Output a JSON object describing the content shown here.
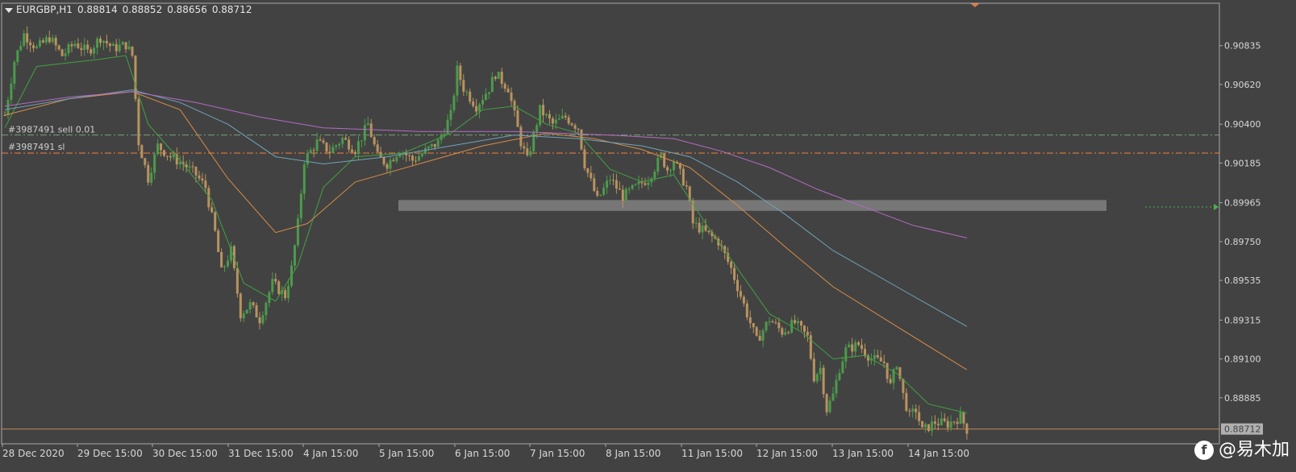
{
  "header": {
    "symbol": "EURGBP,H1",
    "open": "0.88814",
    "high": "0.88852",
    "low": "0.88656",
    "close": "0.88712"
  },
  "orders": {
    "sell_label": "#3987491 sell 0.01",
    "sl_label": "#3987491 sl"
  },
  "watermark": "@易木加",
  "colors": {
    "background": "#424242",
    "bull": "#4c9a4c",
    "bear": "#b8935f",
    "ema_fast": "#42a142",
    "ema_mid": "#d98c45",
    "ema_slow": "#6fa3b8",
    "ema_long": "#b56bc4",
    "sell_line": "#7aa07a",
    "sl_line": "#e07a3a",
    "price_line": "#c08a55",
    "zone": "#8a8a8a"
  },
  "chart_data": {
    "type": "candlestick",
    "y_ticks": [
      "0.90835",
      "0.90620",
      "0.90400",
      "0.90185",
      "0.89965",
      "0.89750",
      "0.89535",
      "0.89315",
      "0.89100",
      "0.88885"
    ],
    "ylim": [
      0.8863,
      0.9107
    ],
    "x_ticks": [
      "28 Dec 2020",
      "29 Dec 15:00",
      "30 Dec 15:00",
      "31 Dec 15:00",
      "4 Jan 15:00",
      "5 Jan 15:00",
      "6 Jan 15:00",
      "7 Jan 15:00",
      "8 Jan 15:00",
      "11 Jan 15:00",
      "12 Jan 15:00",
      "13 Jan 15:00",
      "14 Jan 15:00"
    ],
    "current_price": "0.88712",
    "sell_price": 0.9034,
    "sl_price": 0.9024,
    "zone": {
      "low": 0.8992,
      "high": 0.8998
    },
    "close_path": [
      [
        0,
        0.9045
      ],
      [
        3,
        0.9075
      ],
      [
        6,
        0.909
      ],
      [
        10,
        0.9082
      ],
      [
        14,
        0.9088
      ],
      [
        18,
        0.9078
      ],
      [
        22,
        0.9085
      ],
      [
        26,
        0.908
      ],
      [
        30,
        0.9088
      ],
      [
        34,
        0.9082
      ],
      [
        38,
        0.9084
      ],
      [
        40,
        0.9078
      ],
      [
        42,
        0.903
      ],
      [
        45,
        0.901
      ],
      [
        48,
        0.9028
      ],
      [
        52,
        0.9022
      ],
      [
        56,
        0.9018
      ],
      [
        60,
        0.9012
      ],
      [
        63,
        0.9005
      ],
      [
        66,
        0.898
      ],
      [
        68,
        0.8958
      ],
      [
        71,
        0.897
      ],
      [
        74,
        0.8935
      ],
      [
        77,
        0.894
      ],
      [
        80,
        0.8932
      ],
      [
        84,
        0.8952
      ],
      [
        88,
        0.8945
      ],
      [
        90,
        0.896
      ],
      [
        92,
        0.8985
      ],
      [
        94,
        0.902
      ],
      [
        98,
        0.903
      ],
      [
        102,
        0.9025
      ],
      [
        106,
        0.9032
      ],
      [
        110,
        0.9026
      ],
      [
        114,
        0.904
      ],
      [
        117,
        0.9022
      ],
      [
        120,
        0.9018
      ],
      [
        124,
        0.9026
      ],
      [
        128,
        0.902
      ],
      [
        132,
        0.9025
      ],
      [
        136,
        0.903
      ],
      [
        140,
        0.9045
      ],
      [
        142,
        0.907
      ],
      [
        144,
        0.906
      ],
      [
        148,
        0.905
      ],
      [
        152,
        0.906
      ],
      [
        154,
        0.9068
      ],
      [
        158,
        0.906
      ],
      [
        160,
        0.9045
      ],
      [
        162,
        0.903
      ],
      [
        164,
        0.902
      ],
      [
        168,
        0.9048
      ],
      [
        172,
        0.904
      ],
      [
        176,
        0.9044
      ],
      [
        180,
        0.9038
      ],
      [
        182,
        0.9018
      ],
      [
        186,
        0.8998
      ],
      [
        190,
        0.901
      ],
      [
        194,
        0.9
      ],
      [
        198,
        0.9005
      ],
      [
        202,
        0.901
      ],
      [
        206,
        0.9022
      ],
      [
        208,
        0.9015
      ],
      [
        210,
        0.902
      ],
      [
        214,
        0.9005
      ],
      [
        216,
        0.8985
      ],
      [
        220,
        0.898
      ],
      [
        224,
        0.8975
      ],
      [
        228,
        0.896
      ],
      [
        232,
        0.894
      ],
      [
        236,
        0.892
      ],
      [
        240,
        0.8932
      ],
      [
        244,
        0.8925
      ],
      [
        248,
        0.893
      ],
      [
        252,
        0.8922
      ],
      [
        254,
        0.89
      ],
      [
        256,
        0.8905
      ],
      [
        258,
        0.8882
      ],
      [
        260,
        0.889
      ],
      [
        262,
        0.8905
      ],
      [
        264,
        0.8915
      ],
      [
        268,
        0.8918
      ],
      [
        272,
        0.891
      ],
      [
        276,
        0.8908
      ],
      [
        278,
        0.8895
      ],
      [
        280,
        0.8908
      ],
      [
        282,
        0.889
      ],
      [
        284,
        0.8878
      ],
      [
        286,
        0.8882
      ],
      [
        288,
        0.887
      ],
      [
        292,
        0.8875
      ],
      [
        296,
        0.8874
      ],
      [
        300,
        0.8878
      ],
      [
        302,
        0.8871
      ]
    ],
    "n_bars": 303,
    "ema": [
      {
        "name": "fast",
        "points": [
          [
            0,
            0.9038
          ],
          [
            10,
            0.9072
          ],
          [
            20,
            0.9074
          ],
          [
            30,
            0.9076
          ],
          [
            38,
            0.9078
          ],
          [
            45,
            0.904
          ],
          [
            55,
            0.902
          ],
          [
            65,
            0.8998
          ],
          [
            75,
            0.8952
          ],
          [
            85,
            0.8942
          ],
          [
            92,
            0.8962
          ],
          [
            100,
            0.9005
          ],
          [
            110,
            0.9022
          ],
          [
            125,
            0.9024
          ],
          [
            140,
            0.9035
          ],
          [
            150,
            0.9048
          ],
          [
            160,
            0.905
          ],
          [
            170,
            0.904
          ],
          [
            180,
            0.9035
          ],
          [
            190,
            0.9015
          ],
          [
            200,
            0.9008
          ],
          [
            210,
            0.9012
          ],
          [
            220,
            0.8985
          ],
          [
            230,
            0.896
          ],
          [
            240,
            0.8935
          ],
          [
            250,
            0.8925
          ],
          [
            260,
            0.891
          ],
          [
            270,
            0.8912
          ],
          [
            280,
            0.8902
          ],
          [
            290,
            0.8885
          ],
          [
            302,
            0.888
          ]
        ]
      },
      {
        "name": "mid",
        "points": [
          [
            0,
            0.9045
          ],
          [
            20,
            0.9054
          ],
          [
            40,
            0.9058
          ],
          [
            55,
            0.9048
          ],
          [
            70,
            0.901
          ],
          [
            85,
            0.898
          ],
          [
            95,
            0.8985
          ],
          [
            110,
            0.9008
          ],
          [
            130,
            0.9018
          ],
          [
            150,
            0.9028
          ],
          [
            170,
            0.9035
          ],
          [
            185,
            0.9032
          ],
          [
            200,
            0.9026
          ],
          [
            215,
            0.9016
          ],
          [
            230,
            0.8995
          ],
          [
            245,
            0.8972
          ],
          [
            260,
            0.895
          ],
          [
            280,
            0.8928
          ],
          [
            302,
            0.8904
          ]
        ]
      },
      {
        "name": "slow",
        "points": [
          [
            0,
            0.9048
          ],
          [
            20,
            0.9054
          ],
          [
            40,
            0.9059
          ],
          [
            55,
            0.9052
          ],
          [
            70,
            0.904
          ],
          [
            85,
            0.9022
          ],
          [
            100,
            0.9018
          ],
          [
            120,
            0.9022
          ],
          [
            140,
            0.9028
          ],
          [
            160,
            0.9034
          ],
          [
            180,
            0.9032
          ],
          [
            200,
            0.9028
          ],
          [
            215,
            0.9022
          ],
          [
            230,
            0.9008
          ],
          [
            245,
            0.899
          ],
          [
            260,
            0.897
          ],
          [
            280,
            0.895
          ],
          [
            302,
            0.8928
          ]
        ]
      },
      {
        "name": "long",
        "points": [
          [
            0,
            0.905
          ],
          [
            20,
            0.9055
          ],
          [
            40,
            0.9058
          ],
          [
            60,
            0.9052
          ],
          [
            80,
            0.9044
          ],
          [
            100,
            0.9038
          ],
          [
            130,
            0.9036
          ],
          [
            160,
            0.9036
          ],
          [
            190,
            0.9034
          ],
          [
            210,
            0.9032
          ],
          [
            225,
            0.9025
          ],
          [
            240,
            0.9016
          ],
          [
            255,
            0.9004
          ],
          [
            270,
            0.8994
          ],
          [
            285,
            0.8984
          ],
          [
            302,
            0.8977
          ]
        ]
      }
    ]
  }
}
